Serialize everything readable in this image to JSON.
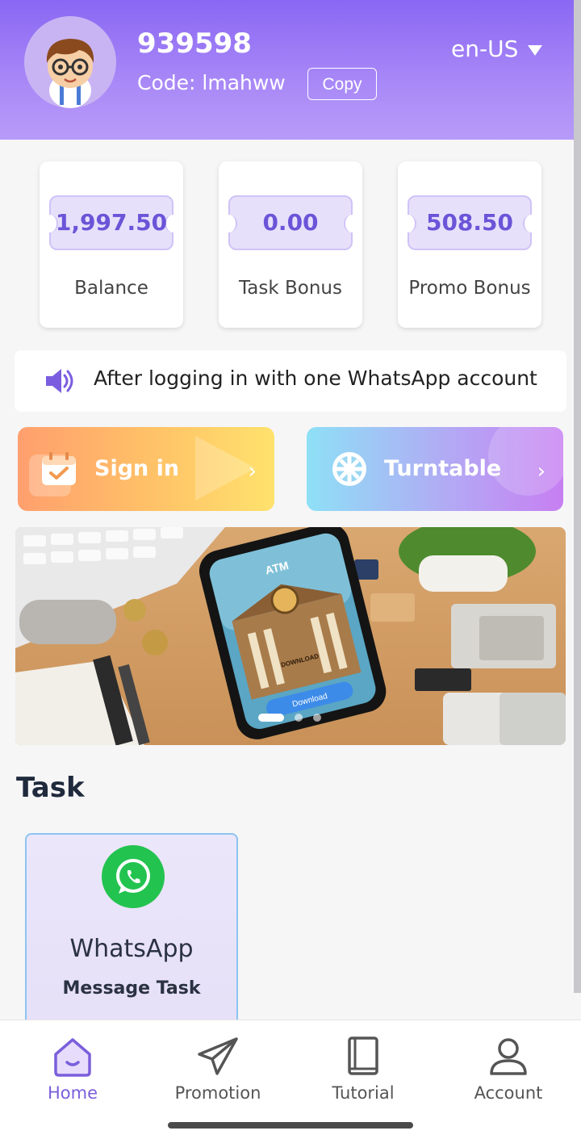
{
  "header": {
    "user_id": "939598",
    "code_label": "Code:",
    "code_value": "lmahww",
    "copy_label": "Copy",
    "language": "en-US"
  },
  "stats": [
    {
      "value": "1,997.50",
      "label": "Balance"
    },
    {
      "value": "0.00",
      "label": "Task Bonus"
    },
    {
      "value": "508.50",
      "label": "Promo Bonus"
    }
  ],
  "notice": {
    "text": "After logging in with one WhatsApp account",
    "icon": "speaker-icon"
  },
  "actions": {
    "sign_in": {
      "label": "Sign in",
      "icon": "calendar-icon"
    },
    "turntable": {
      "label": "Turntable",
      "icon": "wheel-icon"
    }
  },
  "banner": {
    "screen_title": "ATM",
    "screen_caption": "DOWNLOAD",
    "button_label": "Download",
    "slides": 3,
    "active_slide": 1
  },
  "task": {
    "heading": "Task",
    "cards": [
      {
        "title": "WhatsApp",
        "subtitle": "Message Task",
        "icon": "whatsapp-icon"
      }
    ]
  },
  "nav": [
    {
      "label": "Home",
      "icon": "home-icon",
      "active": true
    },
    {
      "label": "Promotion",
      "icon": "paper-plane-icon",
      "active": false
    },
    {
      "label": "Tutorial",
      "icon": "book-icon",
      "active": false
    },
    {
      "label": "Account",
      "icon": "user-icon",
      "active": false
    }
  ],
  "colors": {
    "accent": "#8a67f3",
    "stat_value": "#6a55d8",
    "whatsapp": "#23c350"
  }
}
